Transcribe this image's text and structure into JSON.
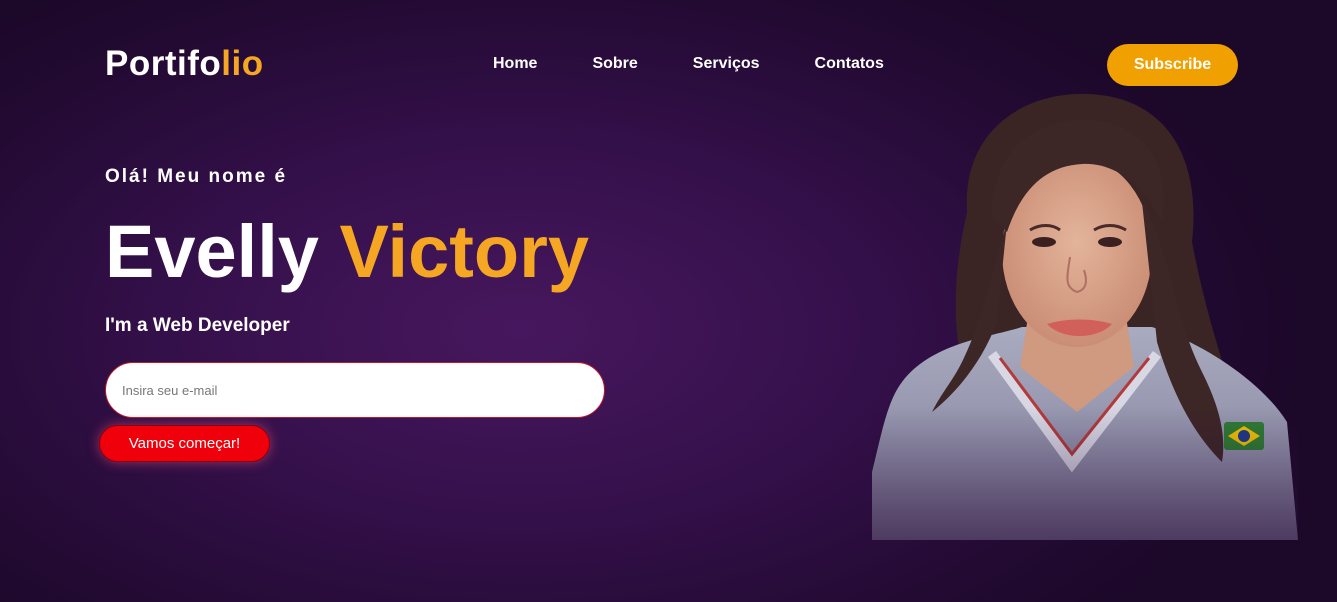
{
  "header": {
    "logo_main": "Portifo",
    "logo_accent": "lio",
    "nav": [
      "Home",
      "Sobre",
      "Serviços",
      "Contatos"
    ],
    "subscribe_label": "Subscribe"
  },
  "hero": {
    "greeting": "Olá! Meu nome é",
    "first_name": "Evelly",
    "last_name": "Victory",
    "role": "I'm a Web Developer",
    "email_placeholder": "Insira seu e-mail",
    "cta_label": "Vamos começar!"
  },
  "colors": {
    "accent": "#f5a623",
    "subscribe_bg": "#f0a000",
    "cta_bg": "#f0000a",
    "background": "#3a1150"
  }
}
